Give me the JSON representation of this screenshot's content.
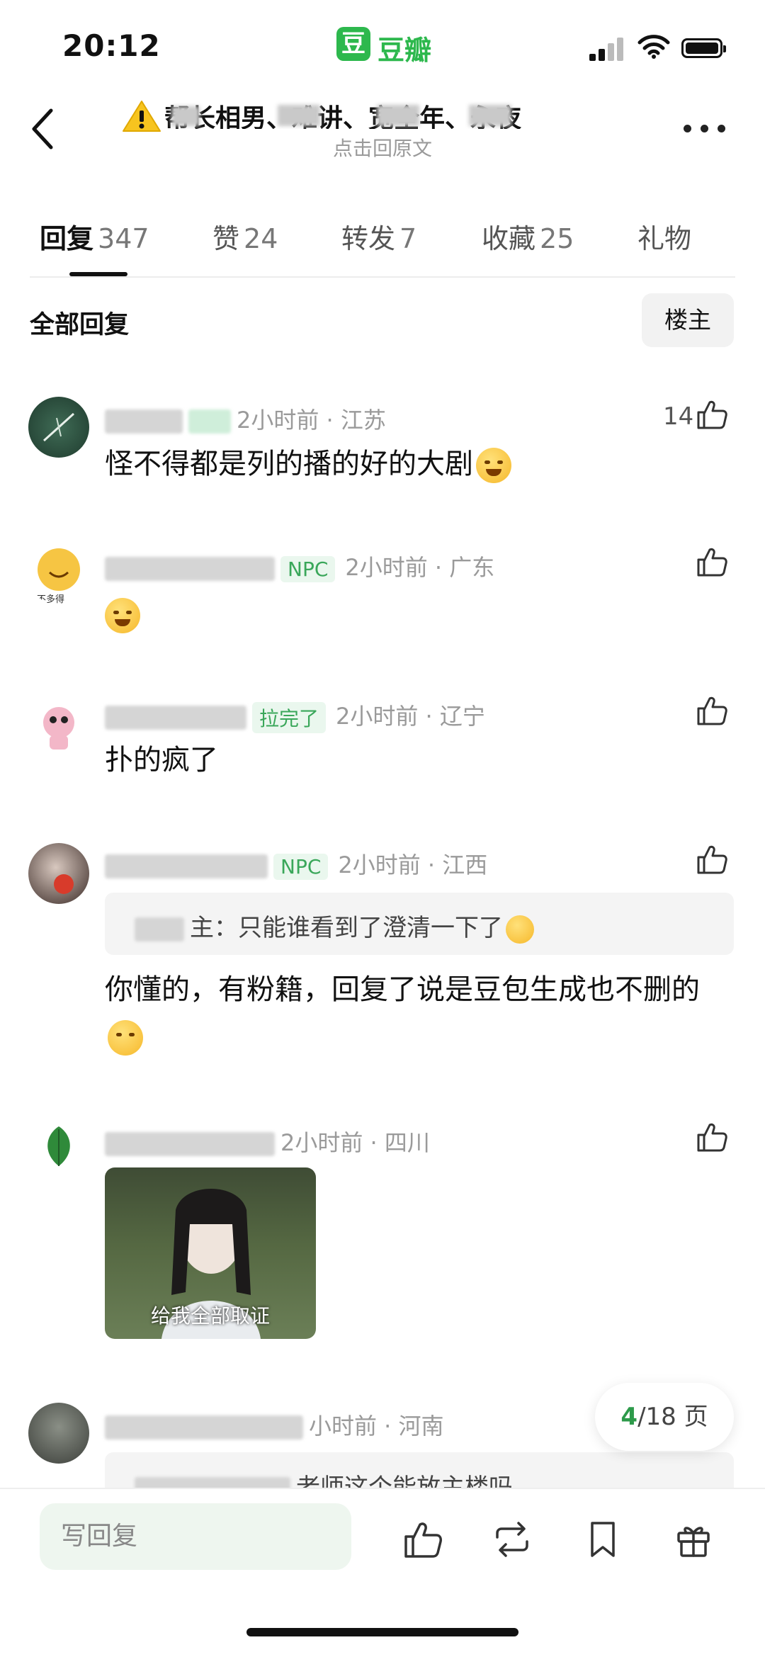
{
  "status_bar": {
    "time": "20:12",
    "app_badge": "豆",
    "app_name": "豆瓣"
  },
  "nav": {
    "title": "帮长相男、难讲、宽全年、永夜",
    "subtitle": "点击回原文"
  },
  "tabs": [
    {
      "label": "回复",
      "count": "347",
      "active": true
    },
    {
      "label": "赞",
      "count": "24"
    },
    {
      "label": "转发",
      "count": "7"
    },
    {
      "label": "收藏",
      "count": "25"
    },
    {
      "label": "礼物",
      "count": ""
    }
  ],
  "section": {
    "title": "全部回复",
    "op_button": "楼主"
  },
  "comments": [
    {
      "name": "sunset",
      "meta": "2小时前 · 江苏",
      "text": "怪不得都是列的播的好的大剧",
      "likes": "14",
      "emoji": "laugh-cry"
    },
    {
      "name": "都是也好吃",
      "tag": "NPC",
      "meta": "2小时前 · 广东",
      "text": "",
      "emoji": "sweat-smile"
    },
    {
      "name": "未提",
      "tag": "拉完了",
      "meta": "2小时前 · 辽宁",
      "text": "扑的疯了"
    },
    {
      "name": "sumo",
      "tag": "NPC",
      "meta": "2小时前 · 江西",
      "quote": "主：只能谁看到了澄清一下了",
      "text": "你懂的，有粉籍，回复了说是豆包生成也不删的",
      "emoji": "unamused"
    },
    {
      "name": "",
      "meta": "2小时前 · 四川",
      "image_caption": "给我全部取证"
    },
    {
      "name": "",
      "meta": "小时前 · 河南",
      "quote": "老师这个能放主楼吗"
    }
  ],
  "pagination": {
    "current": "4",
    "total": "/18 页"
  },
  "bottom_bar": {
    "reply_placeholder": "写回复"
  },
  "colors": {
    "accent": "#2db84d",
    "tag_text": "#3aa75a",
    "tag_bg": "#eaf7ee"
  }
}
